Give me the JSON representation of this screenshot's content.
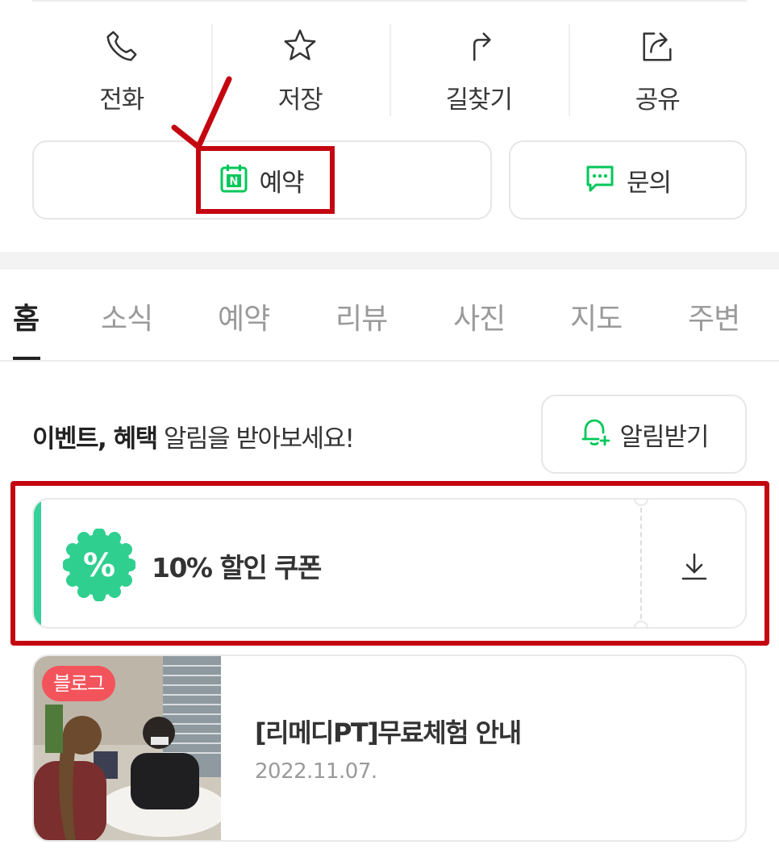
{
  "actions": [
    {
      "label": "전화",
      "icon": "phone-icon"
    },
    {
      "label": "저장",
      "icon": "star-icon"
    },
    {
      "label": "길찾기",
      "icon": "directions-icon"
    },
    {
      "label": "공유",
      "icon": "share-icon"
    }
  ],
  "buttons": {
    "reserve_label": "예약",
    "reserve_icon_letter": "N",
    "inquiry_label": "문의"
  },
  "tabs": [
    "홈",
    "소식",
    "예약",
    "리뷰",
    "사진",
    "지도",
    "주변"
  ],
  "active_tab": "홈",
  "notice": {
    "bold_text": "이벤트, 혜택",
    "text": " 알림을 받아보세요!",
    "button_label": "알림받기"
  },
  "coupon": {
    "title": "10% 할인 쿠폰",
    "seal_text": "%",
    "accent_color": "#35d19b"
  },
  "blog": {
    "badge": "블로그",
    "title": "[리메디PT]무료체험 안내",
    "date": "2022.11.07."
  },
  "colors": {
    "highlight": "#c40610",
    "brand_green": "#03c75a",
    "badge_red": "#f3545c"
  }
}
